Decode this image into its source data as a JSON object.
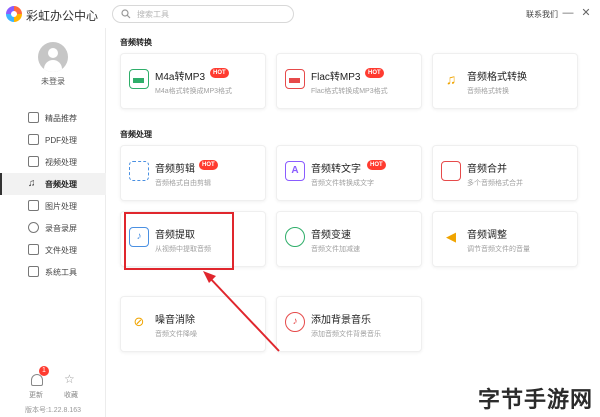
{
  "app": {
    "title": "彩虹办公中心"
  },
  "search": {
    "placeholder": "搜索工具"
  },
  "header": {
    "contact": "联系我们",
    "minimize_icon": "—",
    "close_icon": "✕"
  },
  "user": {
    "login_text": "未登录"
  },
  "sidebar": {
    "items": [
      {
        "label": "精品推荐",
        "icon": "thumbs-up-icon"
      },
      {
        "label": "PDF处理",
        "icon": "pdf-icon"
      },
      {
        "label": "视频处理",
        "icon": "video-icon"
      },
      {
        "label": "音频处理",
        "icon": "music-icon",
        "active": true
      },
      {
        "label": "图片处理",
        "icon": "image-icon"
      },
      {
        "label": "录音录屏",
        "icon": "record-icon"
      },
      {
        "label": "文件处理",
        "icon": "folder-icon"
      },
      {
        "label": "系统工具",
        "icon": "system-icon"
      }
    ],
    "update_label": "更新",
    "update_badge": "1",
    "favorite_label": "收藏",
    "version": "版本号:1.22.8.163"
  },
  "sections": {
    "conversion_title": "音频转换",
    "processing_title": "音频处理"
  },
  "cards": {
    "m4a": {
      "title": "M4a转MP3",
      "desc": "M4a格式转换成MP3格式",
      "hot": "HOT"
    },
    "flac": {
      "title": "Flac转MP3",
      "desc": "Flac格式转换成MP3格式",
      "hot": "HOT"
    },
    "format": {
      "title": "音频格式转换",
      "desc": "音频格式转换"
    },
    "cut": {
      "title": "音频剪辑",
      "desc": "音频格式自由剪辑",
      "hot": "HOT"
    },
    "speech": {
      "title": "音频转文字",
      "desc": "音频文件转换成文字",
      "hot": "HOT"
    },
    "merge": {
      "title": "音频合并",
      "desc": "多个音频格式合并"
    },
    "extract": {
      "title": "音频提取",
      "desc": "从视频中提取音频"
    },
    "speed": {
      "title": "音频变速",
      "desc": "音频文件加减速"
    },
    "volume": {
      "title": "音频调整",
      "desc": "调节音频文件的音量"
    },
    "denoise": {
      "title": "噪音消除",
      "desc": "音频文件降噪"
    },
    "bgm": {
      "title": "添加背景音乐",
      "desc": "添加音频文件背景音乐"
    }
  },
  "colors": {
    "accent_red": "#e0262d",
    "hot_badge": "#ff3b30"
  },
  "watermark": "字节手游网"
}
